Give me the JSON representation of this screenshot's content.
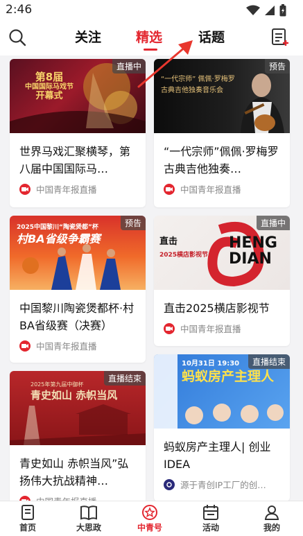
{
  "status": {
    "time": "2:46"
  },
  "header": {
    "tabs": [
      {
        "label": "关注"
      },
      {
        "label": "精选"
      },
      {
        "label": "话题"
      }
    ],
    "active_tab": "精选",
    "accent": "#e3262f"
  },
  "cards": [
    {
      "badge": "直播中",
      "title": "世界马戏汇聚横琴，第八届中国国际马…",
      "source": "中国青年报直播",
      "thumb_text": [
        "第8届",
        "中国国际马戏节",
        "开幕式"
      ]
    },
    {
      "badge": "预告",
      "title": "“一代宗师”佩佩·罗梅罗古典吉他独奏…",
      "source": "中国青年报直播",
      "thumb_text": [
        "“一代宗师” 佩佩·罗梅罗",
        "古典吉他独奏音乐会"
      ]
    },
    {
      "badge": "预告",
      "title": "中国黎川陶瓷煲都杯·村BA省级赛（决赛）",
      "source": "中国青年报直播",
      "thumb_text": [
        "2025中国黎川“陶瓷煲都”杯",
        "村BA省级争霸赛"
      ]
    },
    {
      "badge": "直播中",
      "title": "直击2025横店影视节",
      "source": "中国青年报直播",
      "thumb_text": [
        "直击",
        "2025横店影视节",
        "HENG",
        "DIAN"
      ]
    },
    {
      "badge": "直播结束",
      "title": "青史如山 赤帜当风”弘扬伟大抗战精神…",
      "source": "中国青年报直播",
      "thumb_text": [
        "2025年第九届中御杯",
        "青史如山 赤帜当风"
      ]
    },
    {
      "badge": "直播结束",
      "title": "蚂蚁房产主理人| 创业IDEA",
      "source": "源于青创IP工厂的创…",
      "thumb_text": [
        "10月31日 19:30",
        "蚂蚁房产主理人"
      ]
    }
  ],
  "bottom_nav": [
    {
      "label": "首页",
      "icon": "home-icon"
    },
    {
      "label": "大思政",
      "icon": "book-icon"
    },
    {
      "label": "中青号",
      "icon": "star-badge-icon"
    },
    {
      "label": "活动",
      "icon": "calendar-icon"
    },
    {
      "label": "我的",
      "icon": "user-icon"
    }
  ],
  "active_nav": "中青号"
}
